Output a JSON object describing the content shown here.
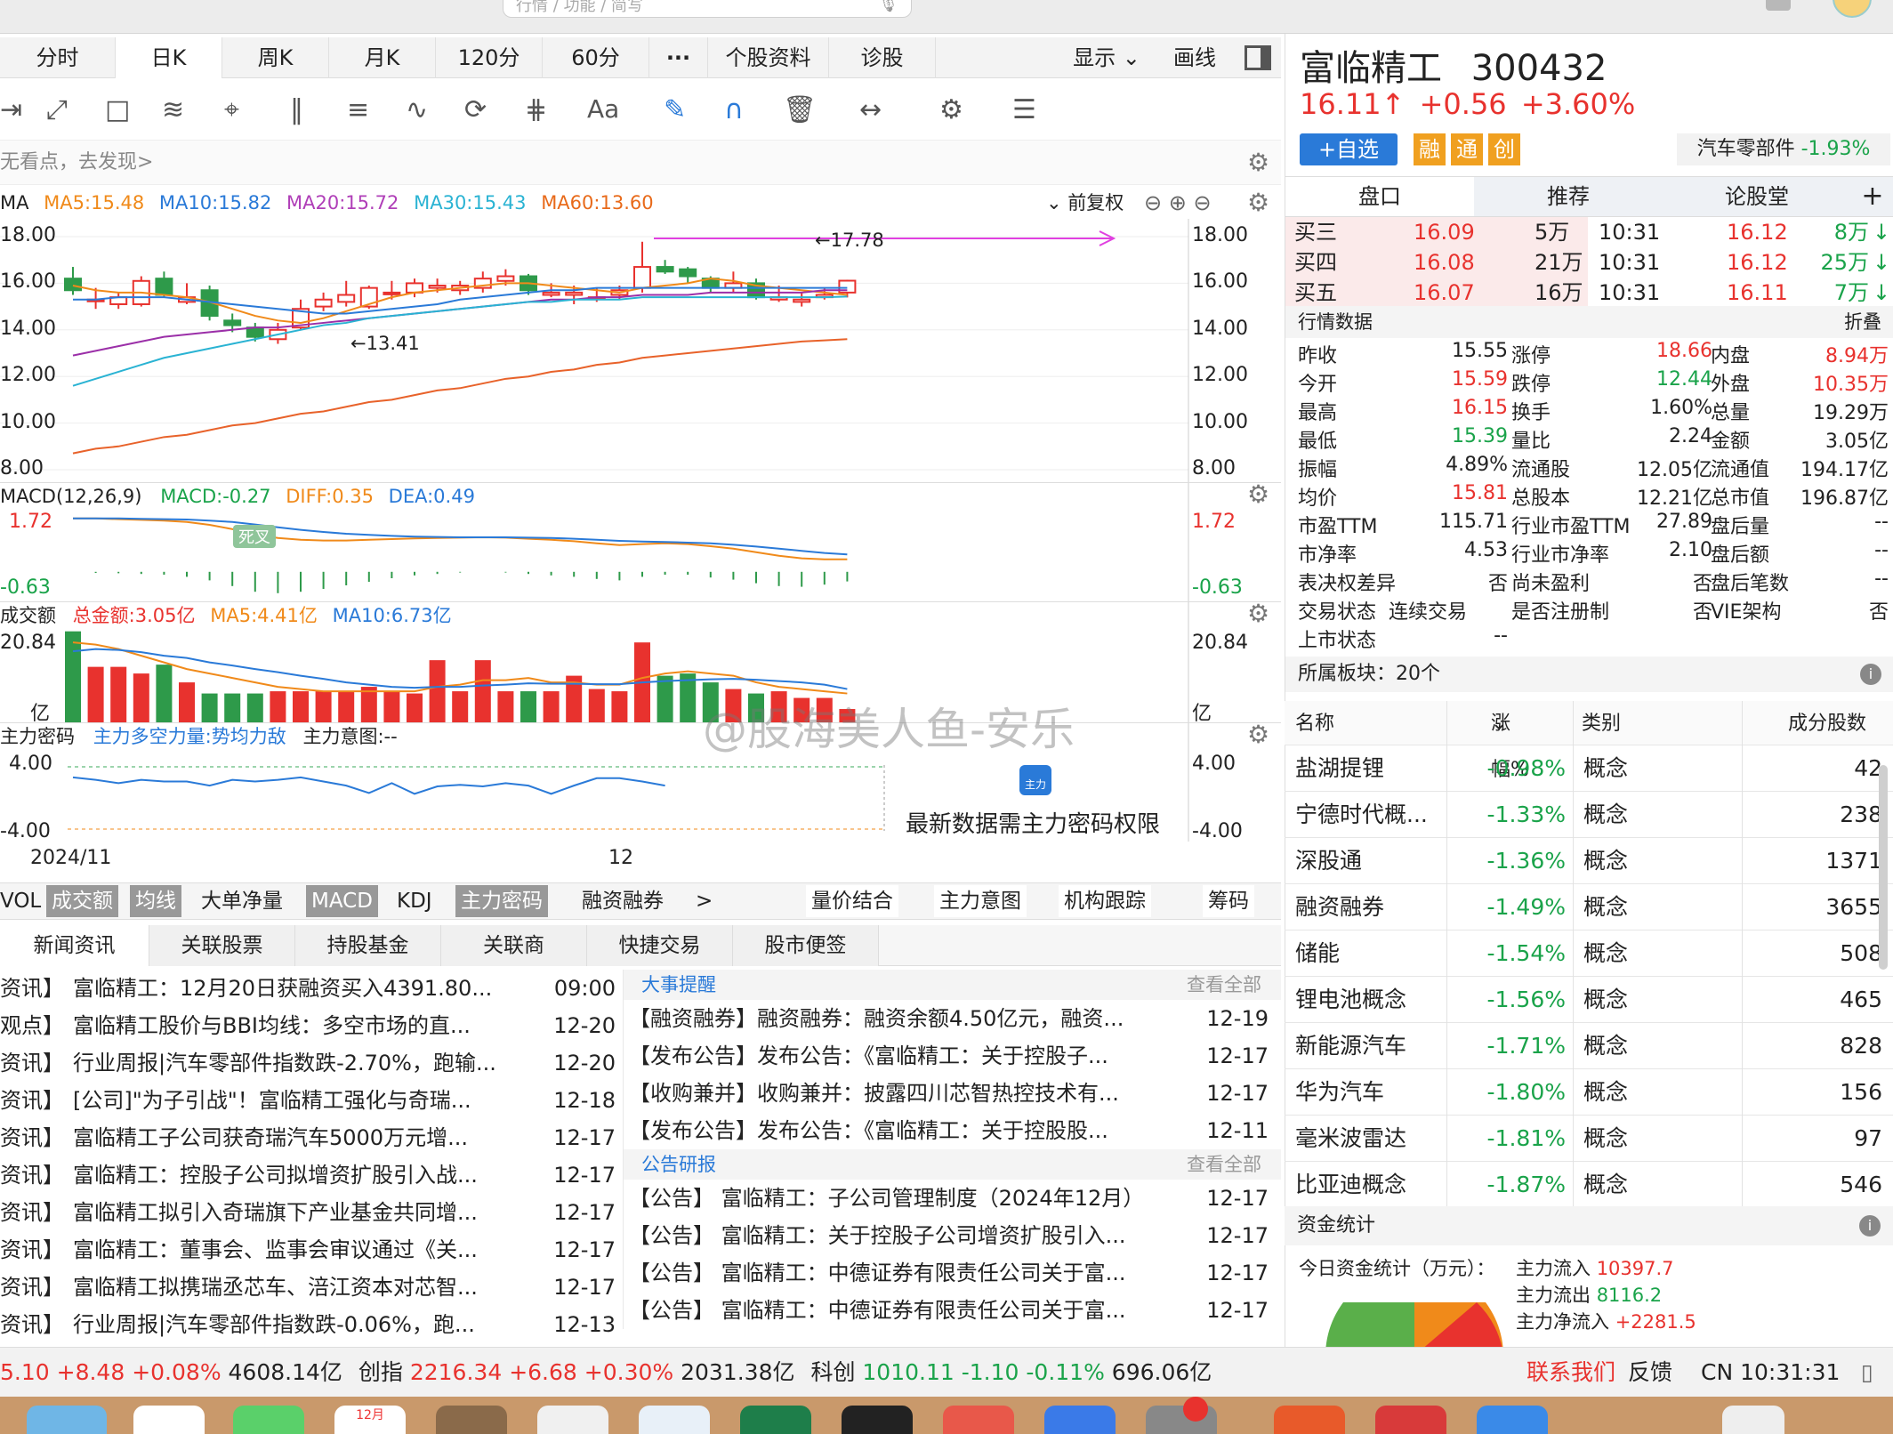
{
  "search": {
    "placeholder": "行情 / 功能 / 简写"
  },
  "tabs": [
    "分时",
    "日K",
    "周K",
    "月K",
    "120分",
    "60分",
    "···",
    "个股资料",
    "诊股"
  ],
  "active_tab": "日K",
  "tabs_right": {
    "display": "显示",
    "draw": "画线"
  },
  "hint": "无看点，去发现>",
  "ma": {
    "label": "MA",
    "ma5": "MA5:15.48",
    "ma10": "MA10:15.82",
    "ma20": "MA20:15.72",
    "ma30": "MA30:15.43",
    "ma60": "MA60:13.60",
    "adjust": "前复权"
  },
  "price_axis": {
    "left": [
      "18.00",
      "16.00",
      "14.00",
      "12.00",
      "10.00",
      "8.00"
    ],
    "right": [
      "18.00",
      "16.00",
      "14.00",
      "12.00",
      "10.00",
      "8.00"
    ],
    "high_label": "←17.78",
    "low_label": "←13.41"
  },
  "macd": {
    "label": "MACD(12,26,9)",
    "macd": "MACD:-0.27",
    "diff": "DIFF:0.35",
    "dea": "DEA:0.49",
    "top": "1.72",
    "bottom": "-0.63",
    "cross": "死叉"
  },
  "volume": {
    "label": "成交额",
    "total": "总金额:3.05亿",
    "ma5": "MA5:4.41亿",
    "ma10": "MA10:6.73亿",
    "top": "20.84",
    "unit": "亿"
  },
  "zl": {
    "label": "主力密码",
    "power": "主力多空力量:势均力敌",
    "intent": "主力意图:--",
    "top": "4.00",
    "bottom": "-4.00",
    "lock_text": "最新数据需主力密码权限",
    "lock_badge": "主力"
  },
  "dates": {
    "d1": "2024/11",
    "d2": "12"
  },
  "watermark": "@股海美人鱼-安乐",
  "indicator_tabs": [
    "VOL",
    "成交额",
    "均线",
    "大单净量",
    "MACD",
    "KDJ",
    "主力密码",
    "融资融券",
    ">"
  ],
  "indicator_tabs_right": [
    "量价结合",
    "主力意图",
    "机构跟踪",
    "筹码"
  ],
  "news_tabs": [
    "新闻资讯",
    "关联股票",
    "持股基金",
    "关联商",
    "快捷交易",
    "股市便签"
  ],
  "news_left": [
    {
      "tag": "资讯】",
      "title": "富临精工：12月20日获融资买入4391.80...",
      "date": "09:00"
    },
    {
      "tag": "观点】",
      "title": "富临精工股价与BBI均线：多空市场的直...",
      "date": "12-20"
    },
    {
      "tag": "资讯】",
      "title": "行业周报|汽车零部件指数跌-2.70%，跑输...",
      "date": "12-20"
    },
    {
      "tag": "资讯】",
      "title": "[公司]\"为子引战\"！富临精工强化与奇瑞...",
      "date": "12-18"
    },
    {
      "tag": "资讯】",
      "title": "富临精工子公司获奇瑞汽车5000万元增...",
      "date": "12-17"
    },
    {
      "tag": "资讯】",
      "title": "富临精工：控股子公司拟增资扩股引入战...",
      "date": "12-17"
    },
    {
      "tag": "资讯】",
      "title": "富临精工拟引入奇瑞旗下产业基金共同增...",
      "date": "12-17"
    },
    {
      "tag": "资讯】",
      "title": "富临精工：董事会、监事会审议通过《关...",
      "date": "12-17"
    },
    {
      "tag": "资讯】",
      "title": "富临精工拟携瑞丞芯车、涪江资本对芯智...",
      "date": "12-17"
    },
    {
      "tag": "资讯】",
      "title": "行业周报|汽车零部件指数跌-0.06%，跑...",
      "date": "12-13"
    }
  ],
  "events_title": "大事提醒",
  "view_all": "查看全部",
  "events": [
    {
      "title": "【融资融券】融资融券：融资余额4.50亿元，融资...",
      "date": "12-19"
    },
    {
      "title": "【发布公告】发布公告：《富临精工：关于控股子...",
      "date": "12-17"
    },
    {
      "title": "【收购兼并】收购兼并：披露四川芯智热控技术有...",
      "date": "12-17"
    },
    {
      "title": "【发布公告】发布公告：《富临精工：关于控股股...",
      "date": "12-11"
    }
  ],
  "reports_title": "公告研报",
  "reports": [
    {
      "title": "【公告】 富临精工：子公司管理制度（2024年12月）",
      "date": "12-17"
    },
    {
      "title": "【公告】 富临精工：关于控股子公司增资扩股引入...",
      "date": "12-17"
    },
    {
      "title": "【公告】 富临精工：中德证券有限责任公司关于富...",
      "date": "12-17"
    },
    {
      "title": "【公告】 富临精工：中德证券有限责任公司关于富...",
      "date": "12-17"
    }
  ],
  "status": {
    "s1": "5.10",
    "s1c": "+8.48",
    "s1p": "+0.08%",
    "s1a": "4608.14亿",
    "cy": "创指",
    "cyv": "2216.34",
    "cyc": "+6.68",
    "cyp": "+0.30%",
    "cya": "2031.38亿",
    "kc": "科创",
    "kcv": "1010.11",
    "kcc": "-1.10",
    "kcp": "-0.11%",
    "kca": "696.06亿",
    "contact": "联系我们",
    "feedback": "反馈",
    "time": "CN 10:31:31"
  },
  "stock": {
    "name": "富临精工",
    "code": "300432",
    "price": "16.11",
    "arrow": "↑",
    "change": "+0.56",
    "pct": "+3.60%",
    "watch": "+自选",
    "badges": [
      "融",
      "通",
      "创"
    ],
    "sector": "汽车零部件",
    "sector_pct": "-1.93%"
  },
  "right_tabs": [
    "盘口",
    "推荐",
    "论股堂",
    "+"
  ],
  "book": [
    {
      "l": "买三",
      "p": "16.09",
      "v": "5万",
      "t": "10:31",
      "tp": "16.12",
      "tv": "8万",
      "a": "↓"
    },
    {
      "l": "买四",
      "p": "16.08",
      "v": "21万",
      "t": "10:31",
      "tp": "16.12",
      "tv": "25万",
      "a": "↓"
    },
    {
      "l": "买五",
      "p": "16.07",
      "v": "16万",
      "t": "10:31",
      "tp": "16.11",
      "tv": "7万",
      "a": "↓"
    }
  ],
  "quote_title": "行情数据",
  "fold": "折叠",
  "quote": [
    [
      "昨收",
      "15.55",
      "涨停",
      "18.66",
      "内盘",
      "8.94万"
    ],
    [
      "今开",
      "15.59",
      "跌停",
      "12.44",
      "外盘",
      "10.35万"
    ],
    [
      "最高",
      "16.15",
      "换手",
      "1.60%",
      "总量",
      "19.29万"
    ],
    [
      "最低",
      "15.39",
      "量比",
      "2.24",
      "金额",
      "3.05亿"
    ],
    [
      "振幅",
      "4.89%",
      "流通股",
      "12.05亿",
      "流通值",
      "194.17亿"
    ],
    [
      "均价",
      "15.81",
      "总股本",
      "12.21亿",
      "总市值",
      "196.87亿"
    ],
    [
      "市盈TTM",
      "115.71",
      "行业市盈TTM",
      "27.89",
      "盘后量",
      "--"
    ],
    [
      "市净率",
      "4.53",
      "行业市净率",
      "2.10",
      "盘后额",
      "--"
    ],
    [
      "表决权差异",
      "否",
      "尚未盈利",
      "否",
      "盘后笔数",
      "--"
    ],
    [
      "交易状态",
      "连续交易",
      "是否注册制",
      "否",
      "VIE架构",
      "否"
    ],
    [
      "上市状态",
      "--",
      "",
      "",
      "",
      ""
    ]
  ],
  "sector_count": "所属板块：20个",
  "sector_head": [
    "名称",
    "涨幅%",
    "类别",
    "成分股数"
  ],
  "sectors": [
    [
      "盐湖提锂",
      "-0.98%",
      "概念",
      "42"
    ],
    [
      "宁德时代概...",
      "-1.33%",
      "概念",
      "238"
    ],
    [
      "深股通",
      "-1.36%",
      "概念",
      "1371"
    ],
    [
      "融资融券",
      "-1.49%",
      "概念",
      "3655"
    ],
    [
      "储能",
      "-1.54%",
      "概念",
      "508"
    ],
    [
      "锂电池概念",
      "-1.56%",
      "概念",
      "465"
    ],
    [
      "新能源汽车",
      "-1.71%",
      "概念",
      "828"
    ],
    [
      "华为汽车",
      "-1.80%",
      "概念",
      "156"
    ],
    [
      "毫米波雷达",
      "-1.81%",
      "概念",
      "97"
    ],
    [
      "比亚迪概念",
      "-1.87%",
      "概念",
      "546"
    ]
  ],
  "fund_title": "资金统计",
  "fund_today": "今日资金统计（万元）：",
  "fund_in": "主力流入",
  "fund_in_v": "10397.7",
  "fund_out": "主力流出",
  "fund_out_v": "8116.2",
  "fund_net": "主力净流入",
  "fund_net_v": "+2281.5",
  "chart_data": {
    "type": "candlestick",
    "ylim": [
      8,
      18
    ],
    "candles": [
      {
        "o": 16.2,
        "c": 15.7,
        "h": 16.7,
        "l": 15.5
      },
      {
        "o": 15.3,
        "c": 15.3,
        "h": 15.8,
        "l": 14.9
      },
      {
        "o": 15.1,
        "c": 15.4,
        "h": 15.6,
        "l": 14.9
      },
      {
        "o": 15.1,
        "c": 16.1,
        "h": 16.3,
        "l": 15.0
      },
      {
        "o": 16.2,
        "c": 15.5,
        "h": 16.5,
        "l": 15.4
      },
      {
        "o": 15.2,
        "c": 15.4,
        "h": 16.0,
        "l": 15.1
      },
      {
        "o": 15.7,
        "c": 14.6,
        "h": 15.9,
        "l": 14.4
      },
      {
        "o": 14.4,
        "c": 14.2,
        "h": 14.7,
        "l": 13.9
      },
      {
        "o": 14.1,
        "c": 13.7,
        "h": 14.3,
        "l": 13.5
      },
      {
        "o": 13.6,
        "c": 14.0,
        "h": 14.3,
        "l": 13.4
      },
      {
        "o": 14.1,
        "c": 14.9,
        "h": 15.3,
        "l": 14.0
      },
      {
        "o": 15.0,
        "c": 15.3,
        "h": 15.6,
        "l": 14.8
      },
      {
        "o": 15.2,
        "c": 15.5,
        "h": 16.1,
        "l": 15.0
      },
      {
        "o": 15.0,
        "c": 15.8,
        "h": 15.9,
        "l": 14.9
      },
      {
        "o": 15.6,
        "c": 15.6,
        "h": 16.1,
        "l": 15.3
      },
      {
        "o": 15.6,
        "c": 16.0,
        "h": 16.2,
        "l": 15.4
      },
      {
        "o": 15.8,
        "c": 15.9,
        "h": 16.2,
        "l": 15.6
      },
      {
        "o": 15.7,
        "c": 15.9,
        "h": 16.1,
        "l": 15.5
      },
      {
        "o": 15.8,
        "c": 16.2,
        "h": 16.5,
        "l": 15.6
      },
      {
        "o": 16.1,
        "c": 16.3,
        "h": 16.6,
        "l": 15.9
      },
      {
        "o": 16.3,
        "c": 15.7,
        "h": 16.4,
        "l": 15.5
      },
      {
        "o": 15.5,
        "c": 15.6,
        "h": 16.0,
        "l": 15.4
      },
      {
        "o": 15.5,
        "c": 15.6,
        "h": 15.9,
        "l": 15.1
      },
      {
        "o": 15.4,
        "c": 15.4,
        "h": 15.8,
        "l": 15.2
      },
      {
        "o": 15.5,
        "c": 15.7,
        "h": 15.9,
        "l": 15.3
      },
      {
        "o": 15.8,
        "c": 16.7,
        "h": 17.78,
        "l": 15.6
      },
      {
        "o": 16.7,
        "c": 16.5,
        "h": 17.0,
        "l": 16.4
      },
      {
        "o": 16.6,
        "c": 16.3,
        "h": 16.7,
        "l": 16.0
      },
      {
        "o": 16.2,
        "c": 15.8,
        "h": 16.3,
        "l": 15.6
      },
      {
        "o": 15.8,
        "c": 16.0,
        "h": 16.5,
        "l": 15.6
      },
      {
        "o": 16.0,
        "c": 15.4,
        "h": 16.2,
        "l": 15.3
      },
      {
        "o": 15.3,
        "c": 15.4,
        "h": 15.9,
        "l": 15.2
      },
      {
        "o": 15.2,
        "c": 15.3,
        "h": 15.6,
        "l": 15.0
      },
      {
        "o": 15.4,
        "c": 15.5,
        "h": 15.8,
        "l": 15.3
      },
      {
        "o": 15.6,
        "c": 16.11,
        "h": 16.15,
        "l": 15.39
      }
    ],
    "ma5": [
      15.9,
      15.7,
      15.6,
      15.6,
      15.5,
      15.4,
      15.2,
      14.9,
      14.6,
      14.4,
      14.3,
      14.5,
      14.8,
      15.1,
      15.4,
      15.6,
      15.7,
      15.8,
      15.9,
      16.0,
      16.0,
      15.9,
      15.8,
      15.7,
      15.6,
      15.8,
      15.9,
      16.0,
      16.2,
      16.1,
      15.9,
      15.8,
      15.7,
      15.6,
      15.5
    ],
    "ma10": [
      15.3,
      15.3,
      15.4,
      15.4,
      15.4,
      15.3,
      15.2,
      15.1,
      15.0,
      14.9,
      14.8,
      14.7,
      14.7,
      14.8,
      14.9,
      15.0,
      15.1,
      15.3,
      15.4,
      15.5,
      15.6,
      15.7,
      15.7,
      15.8,
      15.8,
      15.8,
      15.8,
      15.8,
      15.8,
      15.8,
      15.8,
      15.8,
      15.8,
      15.8,
      15.8
    ],
    "ma20": [
      12.9,
      13.1,
      13.3,
      13.5,
      13.7,
      13.8,
      13.9,
      14.0,
      14.1,
      14.1,
      14.2,
      14.3,
      14.4,
      14.5,
      14.6,
      14.7,
      14.8,
      14.9,
      15.0,
      15.1,
      15.2,
      15.3,
      15.3,
      15.4,
      15.4,
      15.5,
      15.5,
      15.5,
      15.6,
      15.6,
      15.6,
      15.6,
      15.6,
      15.7,
      15.7
    ],
    "ma30": [
      11.6,
      11.9,
      12.2,
      12.5,
      12.8,
      13.0,
      13.2,
      13.4,
      13.6,
      13.8,
      14.0,
      14.2,
      14.3,
      14.5,
      14.6,
      14.7,
      14.8,
      14.9,
      15.0,
      15.1,
      15.2,
      15.2,
      15.3,
      15.3,
      15.3,
      15.4,
      15.4,
      15.4,
      15.4,
      15.4,
      15.4,
      15.4,
      15.4,
      15.4,
      15.43
    ],
    "ma60": [
      8.7,
      8.9,
      9.0,
      9.2,
      9.4,
      9.5,
      9.7,
      9.9,
      10.0,
      10.2,
      10.4,
      10.5,
      10.7,
      10.9,
      11.0,
      11.2,
      11.4,
      11.5,
      11.7,
      11.9,
      12.0,
      12.2,
      12.3,
      12.5,
      12.6,
      12.8,
      12.9,
      13.0,
      13.1,
      13.2,
      13.3,
      13.4,
      13.5,
      13.55,
      13.6
    ],
    "macd_range": [
      -0.63,
      1.72
    ],
    "diff": [
      1.5,
      1.5,
      1.48,
      1.46,
      1.44,
      1.4,
      1.32,
      1.2,
      1.05,
      0.95,
      0.9,
      0.88,
      0.88,
      0.9,
      0.92,
      0.94,
      0.95,
      0.96,
      0.97,
      0.96,
      0.93,
      0.9,
      0.86,
      0.8,
      0.75,
      0.78,
      0.8,
      0.78,
      0.72,
      0.65,
      0.55,
      0.45,
      0.38,
      0.35,
      0.35
    ],
    "dea": [
      1.5,
      1.5,
      1.5,
      1.49,
      1.48,
      1.47,
      1.44,
      1.4,
      1.33,
      1.25,
      1.18,
      1.12,
      1.07,
      1.04,
      1.01,
      0.99,
      0.98,
      0.97,
      0.97,
      0.97,
      0.96,
      0.95,
      0.93,
      0.9,
      0.87,
      0.85,
      0.84,
      0.82,
      0.8,
      0.76,
      0.71,
      0.65,
      0.59,
      0.53,
      0.49
    ],
    "macd_bars": [
      0.0,
      -0.03,
      -0.04,
      -0.06,
      -0.08,
      -0.14,
      -0.24,
      -0.4,
      -0.56,
      -0.6,
      -0.56,
      -0.48,
      -0.38,
      -0.28,
      -0.18,
      -0.1,
      -0.06,
      -0.02,
      0.0,
      -0.02,
      -0.06,
      -0.1,
      -0.14,
      -0.2,
      -0.24,
      -0.14,
      -0.08,
      -0.08,
      -0.16,
      -0.22,
      -0.32,
      -0.4,
      -0.42,
      -0.36,
      -0.27
    ],
    "vol_range": [
      0,
      20.84
    ],
    "volumes": [
      20.5,
      12.5,
      12.5,
      11.0,
      13.0,
      9.0,
      6.5,
      6.5,
      6.5,
      7.0,
      7.0,
      7.0,
      7.0,
      8.0,
      7.0,
      6.5,
      14.0,
      7.0,
      14.0,
      7.0,
      7.0,
      7.0,
      10.5,
      7.5,
      7.0,
      18.0,
      10.5,
      11.0,
      9.0,
      7.5,
      6.5,
      7.0,
      5.5,
      5.5,
      3.0
    ],
    "vol_ma5": [
      18.0,
      17.5,
      16.5,
      15.0,
      13.5,
      12.0,
      11.0,
      10.0,
      9.0,
      8.0,
      7.5,
      7.0,
      7.0,
      7.0,
      7.0,
      7.0,
      8.0,
      8.5,
      9.5,
      9.5,
      10.0,
      9.0,
      9.0,
      8.5,
      8.5,
      10.0,
      11.0,
      11.5,
      11.0,
      10.5,
      9.0,
      8.0,
      7.5,
      7.0,
      6.5
    ],
    "vol_ma10": [
      16.0,
      16.5,
      16.3,
      15.8,
      15.0,
      14.5,
      13.5,
      12.8,
      12.0,
      11.3,
      10.5,
      9.8,
      9.0,
      8.5,
      8.0,
      7.8,
      8.0,
      8.0,
      8.3,
      8.5,
      8.8,
      8.7,
      8.7,
      8.6,
      8.6,
      9.0,
      9.3,
      9.5,
      9.7,
      9.8,
      9.6,
      9.3,
      9.0,
      8.5,
      7.5
    ],
    "zl_range": [
      -4,
      4
    ],
    "zl": [
      2.5,
      2.2,
      1.8,
      2.2,
      2.0,
      2.0,
      1.5,
      2.2,
      2.0,
      2.2,
      2.5,
      2.0,
      1.5,
      0.6,
      1.8,
      0.5,
      1.4,
      1.6,
      1.4,
      1.8,
      1.5,
      0.5,
      1.5,
      2.4,
      2.4,
      2.0,
      1.5
    ]
  }
}
